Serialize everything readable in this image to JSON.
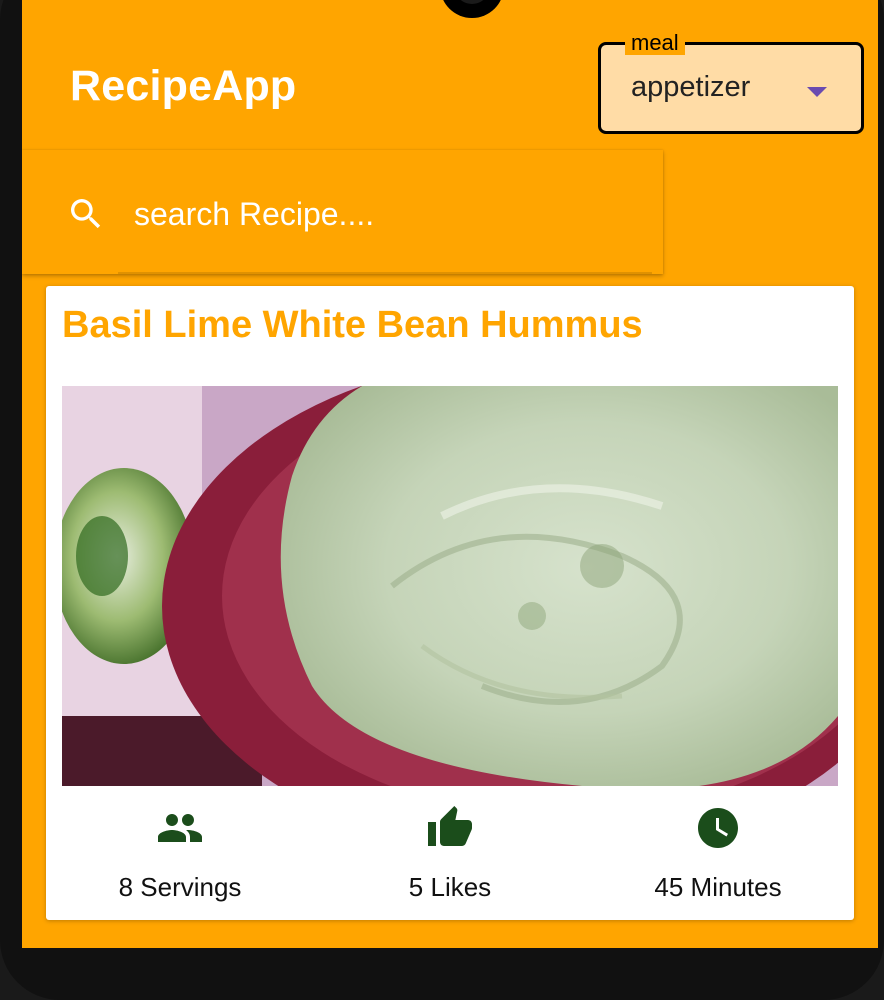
{
  "app": {
    "title": "RecipeApp"
  },
  "meal_filter": {
    "label": "meal",
    "value": "appetizer"
  },
  "search": {
    "placeholder": "search Recipe...."
  },
  "recipe": {
    "title": "Basil Lime White Bean Hummus",
    "image_alt": "Basil Lime White Bean Hummus",
    "stats": {
      "servings": "8 Servings",
      "likes": "5 Likes",
      "time": "45 Minutes"
    }
  },
  "colors": {
    "primary": "#FFA500",
    "select_bg": "#FFDCA6",
    "icon_green": "#1B4D1B",
    "dropdown_arrow": "#6A4BB0"
  },
  "icons": {
    "search": "search-icon",
    "servings": "people-icon",
    "likes": "thumb-up-icon",
    "time": "clock-icon",
    "dropdown": "arrow-drop-down-icon"
  }
}
